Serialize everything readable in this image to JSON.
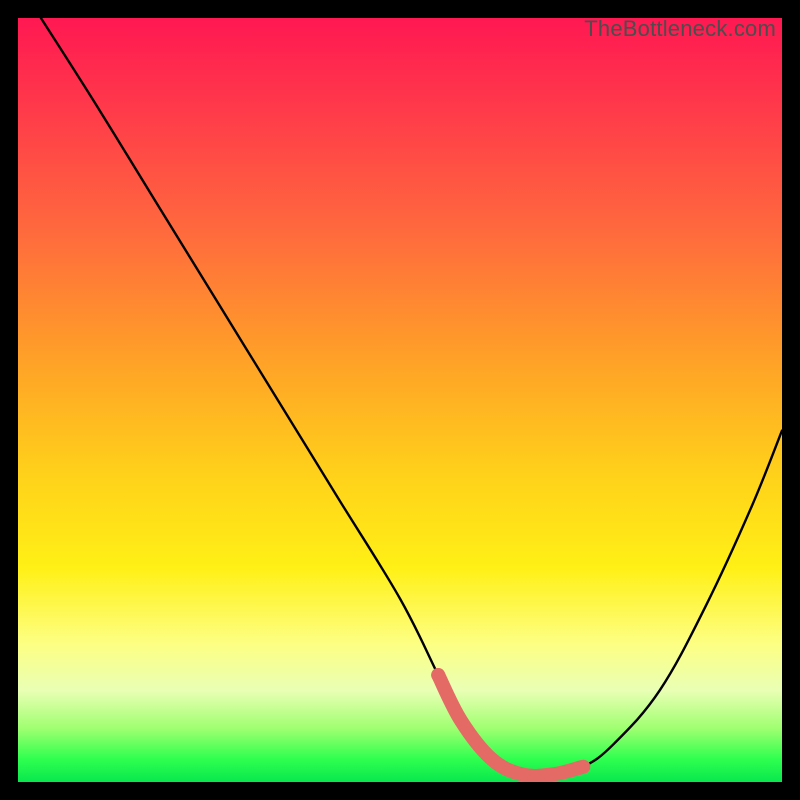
{
  "watermark": "TheBottleneck.com",
  "colors": {
    "curve": "#000000",
    "highlight": "#e46a66",
    "highlight_dot": "#e46a66",
    "frame": "#000000"
  },
  "chart_data": {
    "type": "line",
    "title": "",
    "xlabel": "",
    "ylabel": "",
    "xlim": [
      0,
      100
    ],
    "ylim": [
      0,
      100
    ],
    "grid": false,
    "series": [
      {
        "name": "bottleneck-curve",
        "x": [
          3,
          10,
          18,
          26,
          34,
          42,
          50,
          55,
          58,
          62,
          66,
          70,
          74,
          78,
          84,
          90,
          96,
          100
        ],
        "y": [
          100,
          89,
          76,
          63,
          50,
          37,
          24,
          14,
          8,
          3,
          1,
          1,
          2,
          5,
          12,
          23,
          36,
          46
        ]
      }
    ],
    "highlight": {
      "start_x": 55,
      "end_x": 74,
      "dot_x": 55
    }
  }
}
